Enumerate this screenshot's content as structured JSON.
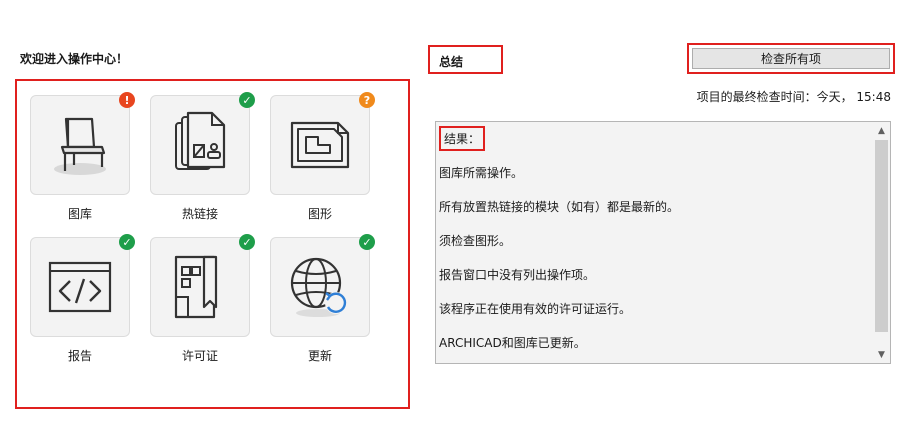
{
  "welcome": "欢迎进入操作中心！",
  "tiles": [
    {
      "label": "图库",
      "status": "error",
      "badge": "!",
      "icon": "chair-icon"
    },
    {
      "label": "热链接",
      "status": "ok",
      "badge": "✓",
      "icon": "hotlink-icon"
    },
    {
      "label": "图形",
      "status": "warning",
      "badge": "?",
      "icon": "drawing-icon"
    },
    {
      "label": "报告",
      "status": "ok",
      "badge": "✓",
      "icon": "code-icon"
    },
    {
      "label": "许可证",
      "status": "ok",
      "badge": "✓",
      "icon": "license-icon"
    },
    {
      "label": "更新",
      "status": "ok",
      "badge": "✓",
      "icon": "globe-update-icon"
    }
  ],
  "summary": {
    "title": "总结",
    "check_button": "检查所有项",
    "last_check": "项目的最终检查时间：今天， 15:48"
  },
  "results": {
    "header": "结果：",
    "lines": [
      "图库所需操作。",
      "所有放置热链接的模块（如有）都是最新的。",
      "须检查图形。",
      "报告窗口中没有列出操作项。",
      "该程序正在使用有效的许可证运行。",
      "ARCHICAD和图库已更新。"
    ]
  },
  "colors": {
    "highlight": "#e0201e",
    "ok": "#1e9e4a",
    "error": "#e8461f",
    "warning": "#f08a1c"
  }
}
